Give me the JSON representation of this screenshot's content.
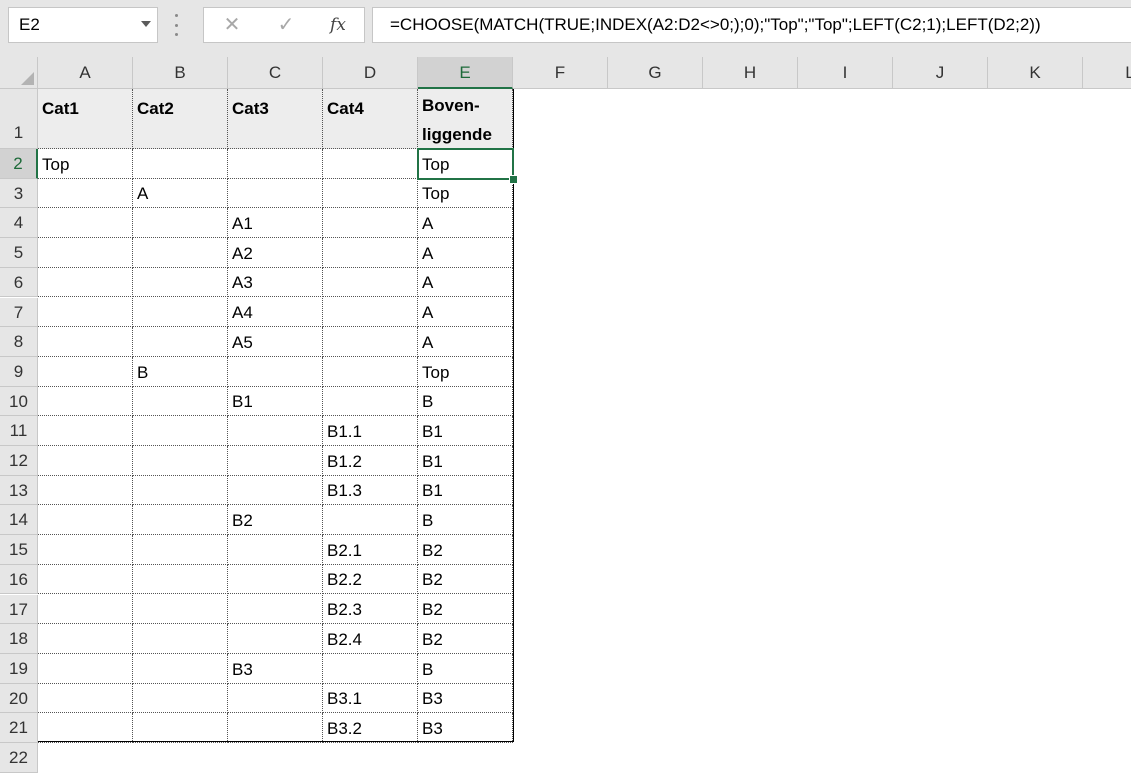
{
  "name_box": {
    "value": "E2"
  },
  "formula_bar": {
    "cancel_glyph": "✕",
    "enter_glyph": "✓",
    "fx_label": "fx",
    "formula": "=CHOOSE(MATCH(TRUE;INDEX(A2:D2<>0;);0);\"Top\";\"Top\";LEFT(C2;1);LEFT(D2;2))"
  },
  "columns": [
    "A",
    "B",
    "C",
    "D",
    "E",
    "F",
    "G",
    "H",
    "I",
    "J",
    "K",
    "L"
  ],
  "rows": [
    "1",
    "2",
    "3",
    "4",
    "5",
    "6",
    "7",
    "8",
    "9",
    "10",
    "11",
    "12",
    "13",
    "14",
    "15",
    "16",
    "17",
    "18",
    "19",
    "20",
    "21",
    "22"
  ],
  "selected": {
    "column": "E",
    "row": "2"
  },
  "header_row": [
    "Cat1",
    "Cat2",
    "Cat3",
    "Cat4",
    "Boven-liggende"
  ],
  "table": [
    [
      "Top",
      "",
      "",
      "",
      "Top"
    ],
    [
      "",
      "A",
      "",
      "",
      "Top"
    ],
    [
      "",
      "",
      "A1",
      "",
      "A"
    ],
    [
      "",
      "",
      "A2",
      "",
      "A"
    ],
    [
      "",
      "",
      "A3",
      "",
      "A"
    ],
    [
      "",
      "",
      "A4",
      "",
      "A"
    ],
    [
      "",
      "",
      "A5",
      "",
      "A"
    ],
    [
      "",
      "B",
      "",
      "",
      "Top"
    ],
    [
      "",
      "",
      "B1",
      "",
      "B"
    ],
    [
      "",
      "",
      "",
      "B1.1",
      "B1"
    ],
    [
      "",
      "",
      "",
      "B1.2",
      "B1"
    ],
    [
      "",
      "",
      "",
      "B1.3",
      "B1"
    ],
    [
      "",
      "",
      "B2",
      "",
      "B"
    ],
    [
      "",
      "",
      "",
      "B2.1",
      "B2"
    ],
    [
      "",
      "",
      "",
      "B2.2",
      "B2"
    ],
    [
      "",
      "",
      "",
      "B2.3",
      "B2"
    ],
    [
      "",
      "",
      "",
      "B2.4",
      "B2"
    ],
    [
      "",
      "",
      "B3",
      "",
      "B"
    ],
    [
      "",
      "",
      "",
      "B3.1",
      "B3"
    ],
    [
      "",
      "",
      "",
      "B3.2",
      "B3"
    ]
  ]
}
